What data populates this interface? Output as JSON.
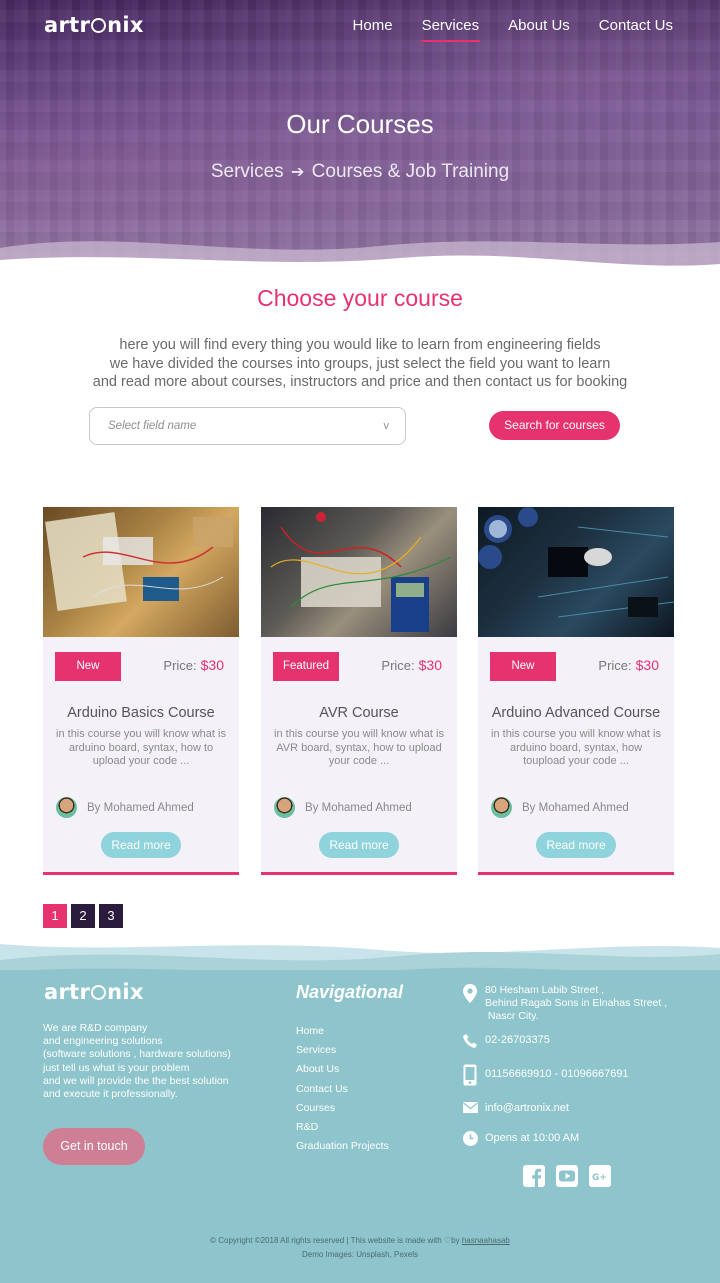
{
  "header": {
    "logo_text_a": "artr",
    "logo_text_b": "nix",
    "nav": [
      "Home",
      "Services",
      "About Us",
      "Contact Us"
    ],
    "active_nav": "Services"
  },
  "hero": {
    "title": "Our Courses",
    "crumb_parent": "Services",
    "crumb_arrow": "➔",
    "crumb_current": "Courses & Job Training"
  },
  "intro": {
    "heading": "Choose your course",
    "lines": [
      "here you will find every thing you would like to learn from engineering fields",
      "we have divided the courses into groups, just select the field you want to learn",
      "and read more about courses, instructors and price and then contact us for booking"
    ]
  },
  "search": {
    "placeholder": "Select field name",
    "chevron": "v",
    "button": "Search for courses"
  },
  "courses": [
    {
      "badge": "New",
      "price_label": "Price:",
      "price": "$30",
      "title": "Arduino Basics Course",
      "desc": "in this course you will know what is arduino board, syntax, how to upload your code ...",
      "author": "By Mohamed Ahmed",
      "button": "Read more"
    },
    {
      "badge": "Featured",
      "price_label": "Price:",
      "price": "$30",
      "title": "AVR Course",
      "desc": "in this course you will know what is AVR board, syntax, how to upload your code ...",
      "author": "By Mohamed Ahmed",
      "button": "Read more"
    },
    {
      "badge": "New",
      "price_label": "Price:",
      "price": "$30",
      "title": "Arduino Advanced Course",
      "desc": "in this course you will know what is arduino board, syntax, how toupload your code ...",
      "author": "By Mohamed Ahmed",
      "button": "Read more"
    }
  ],
  "pagination": {
    "pages": [
      "1",
      "2",
      "3"
    ],
    "current": "1"
  },
  "footer": {
    "about_lines": [
      "We are R&D company",
      "and engineering solutions",
      "(software solutions , hardware solutions)",
      "just tell us what is your problem",
      "and we will provide the the best solution",
      "and execute it professionally."
    ],
    "cta": "Get in touch",
    "nav_title": "Navigational",
    "nav_items": [
      "Home",
      "Services",
      "About Us",
      "Contact Us",
      "Courses",
      "R&D",
      "Graduation Projects"
    ],
    "address": [
      "80 Hesham Labib Street ,",
      "Behind Ragab Sons in Elnahas Street ,",
      " Nascr City."
    ],
    "phone": "02-26703375",
    "mobile": "01156669910 - 01096667691",
    "email": "info@artronix.net",
    "hours": "Opens at 10:00 AM",
    "socials": [
      "facebook-icon",
      "youtube-icon",
      "google-plus-icon"
    ],
    "copyright": "© Copyright ©2018 All rights reserved | This website is made with",
    "copyright_by": "by",
    "author_link": "hasnaahasab",
    "demo": "Demo Images: Unsplash, Pexels"
  },
  "colors": {
    "accent": "#e6326e",
    "teal": "#8ec5cc",
    "dark": "#2b1c3d",
    "button_teal": "#8fd3dc"
  }
}
